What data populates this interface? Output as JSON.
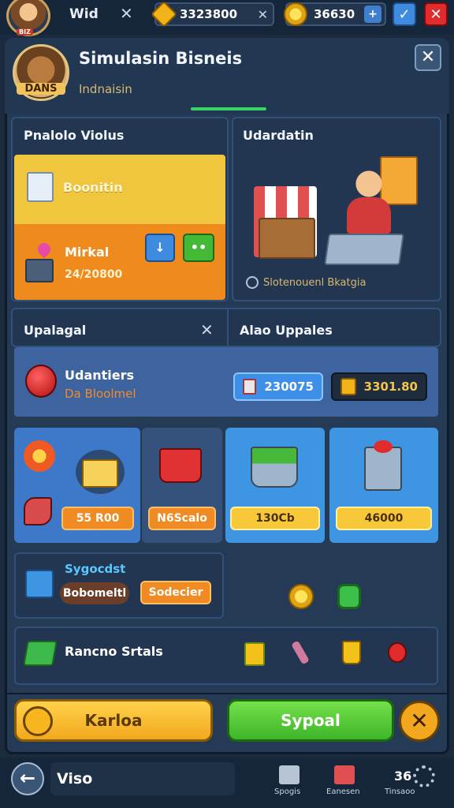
{
  "top_bar": {
    "avatar_badge": "BIZ",
    "player_name": "Wid",
    "close_symbol": "✕",
    "gems": "3323800",
    "coins": "36630",
    "plus_symbol": "+",
    "blue_symbol": "✓",
    "red_symbol": "✕"
  },
  "header": {
    "logo_text": "DANS",
    "title": "Simulasin Bisneis",
    "subtitle": "Indnaisin",
    "close_symbol": "✕"
  },
  "status": {
    "title": "Pnalolo Violus",
    "item1_label": "Boonitin",
    "item2_label": "Mirkal",
    "item2_value": "24/20800",
    "blue_btn_symbol": "↓",
    "green_btn_symbol": "••"
  },
  "illustration": {
    "title": "Udardatin",
    "caption": "Slotenouenl Bkatgia"
  },
  "upgrades": {
    "left_title": "Upalagal",
    "close_symbol": "✕",
    "right_title": "Alao Uppales",
    "item_title": "Udantiers",
    "item_sub": "Da Bloolmel",
    "price1": "230075",
    "price2": "3301.80"
  },
  "cards": [
    {
      "price": "55 R00"
    },
    {
      "price": "N6Scalo"
    },
    {
      "price": "130Cb"
    },
    {
      "price": "46000"
    }
  ],
  "special": {
    "title": "Sygocdst",
    "subtitle": "Bobomeltl",
    "button": "Sodecier"
  },
  "resources": {
    "label": "Rancno Srtals"
  },
  "actions": {
    "left_button": "Karloa",
    "right_button": "Sypoal",
    "cancel_symbol": "✕"
  },
  "nav": {
    "back_symbol": "←",
    "label": "Viso",
    "item1": "Spogis",
    "item2": "Eanesen",
    "item3": "Tinsaoo",
    "item3_top": "36"
  },
  "colors": {
    "accent_green": "#38d466",
    "panel_blue": "#243a55",
    "gold": "#f0c63e",
    "orange": "#ef8a1c"
  }
}
